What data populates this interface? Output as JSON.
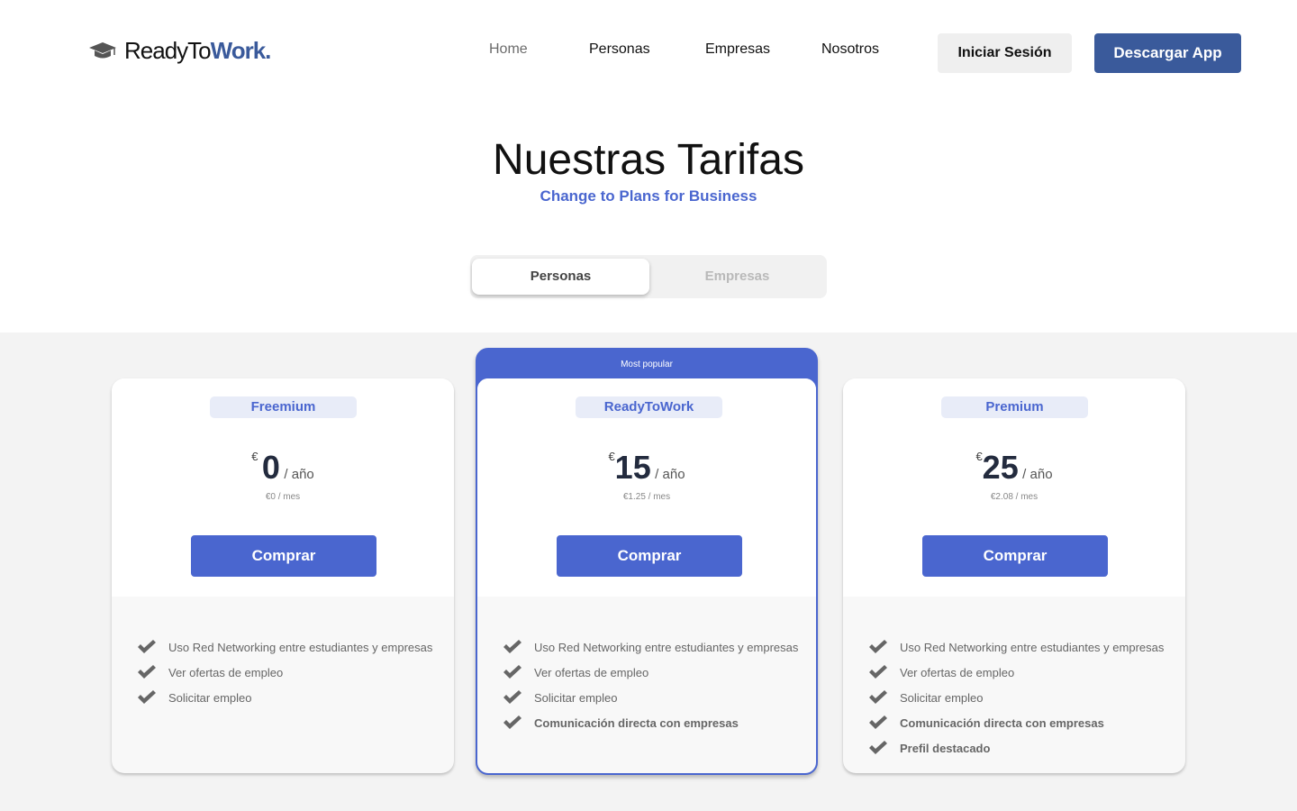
{
  "header": {
    "logo_part1": "ReadyTo",
    "logo_part2": "Work.",
    "nav": [
      "Home",
      "Personas",
      "Empresas",
      "Nosotros"
    ],
    "login_label": "Iniciar Sesión",
    "download_label": "Descargar App"
  },
  "hero": {
    "title": "Nuestras Tarifas",
    "subtitle": "Change to Plans for Business"
  },
  "toggle": {
    "options": [
      "Personas",
      "Empresas"
    ],
    "selected": "Personas"
  },
  "plans": [
    {
      "name": "Freemium",
      "currency": "€",
      "price": "0",
      "period": "/ año",
      "monthly": "€0 / mes",
      "button": "Comprar",
      "features": [
        {
          "text": "Uso Red Networking entre estudiantes y empresas",
          "bold": false
        },
        {
          "text": "Ver ofertas de empleo",
          "bold": false
        },
        {
          "text": "Solicitar empleo",
          "bold": false
        }
      ]
    },
    {
      "name": "ReadyToWork",
      "popular_label": "Most popular",
      "currency": "€",
      "price": "15",
      "period": "/ año",
      "monthly": "€1.25 / mes",
      "button": "Comprar",
      "features": [
        {
          "text": "Uso Red Networking entre estudiantes y empresas",
          "bold": false
        },
        {
          "text": "Ver ofertas de empleo",
          "bold": false
        },
        {
          "text": "Solicitar empleo",
          "bold": false
        },
        {
          "text": "Comunicación directa con empresas",
          "bold": true
        }
      ]
    },
    {
      "name": "Premium",
      "currency": "€",
      "price": "25",
      "period": "/ año",
      "monthly": "€2.08 / mes",
      "button": "Comprar",
      "features": [
        {
          "text": "Uso Red Networking entre estudiantes y empresas",
          "bold": false
        },
        {
          "text": "Ver ofertas de empleo",
          "bold": false
        },
        {
          "text": "Solicitar empleo",
          "bold": false
        },
        {
          "text": "Comunicación directa con empresas",
          "bold": true
        },
        {
          "text": "Prefil destacado",
          "bold": true
        }
      ]
    }
  ],
  "colors": {
    "brand": "#3a5a9b",
    "accent": "#4a66cf",
    "section_bg": "#f3f3f3"
  },
  "icons": {
    "logo": "graduation-cap-icon",
    "feature": "check-icon"
  }
}
